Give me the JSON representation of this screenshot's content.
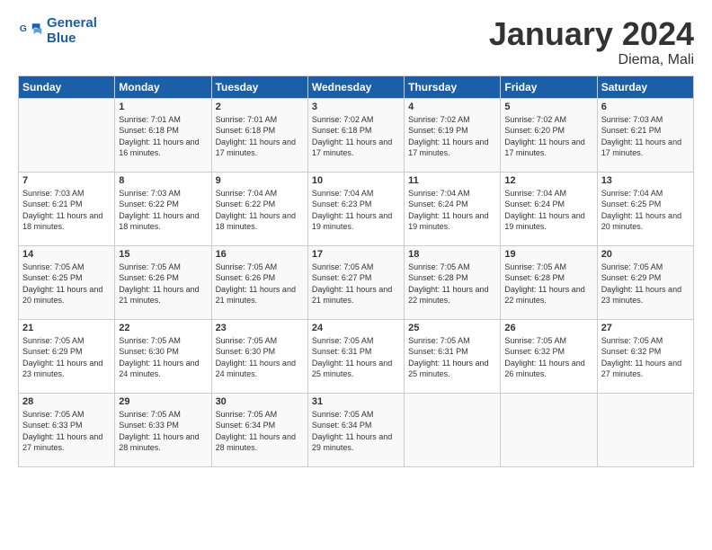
{
  "header": {
    "logo_line1": "General",
    "logo_line2": "Blue",
    "title": "January 2024",
    "location": "Diema, Mali"
  },
  "weekdays": [
    "Sunday",
    "Monday",
    "Tuesday",
    "Wednesday",
    "Thursday",
    "Friday",
    "Saturday"
  ],
  "weeks": [
    [
      {
        "day": "",
        "sunrise": "",
        "sunset": "",
        "daylight": ""
      },
      {
        "day": "1",
        "sunrise": "Sunrise: 7:01 AM",
        "sunset": "Sunset: 6:18 PM",
        "daylight": "Daylight: 11 hours and 16 minutes."
      },
      {
        "day": "2",
        "sunrise": "Sunrise: 7:01 AM",
        "sunset": "Sunset: 6:18 PM",
        "daylight": "Daylight: 11 hours and 17 minutes."
      },
      {
        "day": "3",
        "sunrise": "Sunrise: 7:02 AM",
        "sunset": "Sunset: 6:18 PM",
        "daylight": "Daylight: 11 hours and 17 minutes."
      },
      {
        "day": "4",
        "sunrise": "Sunrise: 7:02 AM",
        "sunset": "Sunset: 6:19 PM",
        "daylight": "Daylight: 11 hours and 17 minutes."
      },
      {
        "day": "5",
        "sunrise": "Sunrise: 7:02 AM",
        "sunset": "Sunset: 6:20 PM",
        "daylight": "Daylight: 11 hours and 17 minutes."
      },
      {
        "day": "6",
        "sunrise": "Sunrise: 7:03 AM",
        "sunset": "Sunset: 6:21 PM",
        "daylight": "Daylight: 11 hours and 17 minutes."
      }
    ],
    [
      {
        "day": "7",
        "sunrise": "Sunrise: 7:03 AM",
        "sunset": "Sunset: 6:21 PM",
        "daylight": "Daylight: 11 hours and 18 minutes."
      },
      {
        "day": "8",
        "sunrise": "Sunrise: 7:03 AM",
        "sunset": "Sunset: 6:22 PM",
        "daylight": "Daylight: 11 hours and 18 minutes."
      },
      {
        "day": "9",
        "sunrise": "Sunrise: 7:04 AM",
        "sunset": "Sunset: 6:22 PM",
        "daylight": "Daylight: 11 hours and 18 minutes."
      },
      {
        "day": "10",
        "sunrise": "Sunrise: 7:04 AM",
        "sunset": "Sunset: 6:23 PM",
        "daylight": "Daylight: 11 hours and 19 minutes."
      },
      {
        "day": "11",
        "sunrise": "Sunrise: 7:04 AM",
        "sunset": "Sunset: 6:24 PM",
        "daylight": "Daylight: 11 hours and 19 minutes."
      },
      {
        "day": "12",
        "sunrise": "Sunrise: 7:04 AM",
        "sunset": "Sunset: 6:24 PM",
        "daylight": "Daylight: 11 hours and 19 minutes."
      },
      {
        "day": "13",
        "sunrise": "Sunrise: 7:04 AM",
        "sunset": "Sunset: 6:25 PM",
        "daylight": "Daylight: 11 hours and 20 minutes."
      }
    ],
    [
      {
        "day": "14",
        "sunrise": "Sunrise: 7:05 AM",
        "sunset": "Sunset: 6:25 PM",
        "daylight": "Daylight: 11 hours and 20 minutes."
      },
      {
        "day": "15",
        "sunrise": "Sunrise: 7:05 AM",
        "sunset": "Sunset: 6:26 PM",
        "daylight": "Daylight: 11 hours and 21 minutes."
      },
      {
        "day": "16",
        "sunrise": "Sunrise: 7:05 AM",
        "sunset": "Sunset: 6:26 PM",
        "daylight": "Daylight: 11 hours and 21 minutes."
      },
      {
        "day": "17",
        "sunrise": "Sunrise: 7:05 AM",
        "sunset": "Sunset: 6:27 PM",
        "daylight": "Daylight: 11 hours and 21 minutes."
      },
      {
        "day": "18",
        "sunrise": "Sunrise: 7:05 AM",
        "sunset": "Sunset: 6:28 PM",
        "daylight": "Daylight: 11 hours and 22 minutes."
      },
      {
        "day": "19",
        "sunrise": "Sunrise: 7:05 AM",
        "sunset": "Sunset: 6:28 PM",
        "daylight": "Daylight: 11 hours and 22 minutes."
      },
      {
        "day": "20",
        "sunrise": "Sunrise: 7:05 AM",
        "sunset": "Sunset: 6:29 PM",
        "daylight": "Daylight: 11 hours and 23 minutes."
      }
    ],
    [
      {
        "day": "21",
        "sunrise": "Sunrise: 7:05 AM",
        "sunset": "Sunset: 6:29 PM",
        "daylight": "Daylight: 11 hours and 23 minutes."
      },
      {
        "day": "22",
        "sunrise": "Sunrise: 7:05 AM",
        "sunset": "Sunset: 6:30 PM",
        "daylight": "Daylight: 11 hours and 24 minutes."
      },
      {
        "day": "23",
        "sunrise": "Sunrise: 7:05 AM",
        "sunset": "Sunset: 6:30 PM",
        "daylight": "Daylight: 11 hours and 24 minutes."
      },
      {
        "day": "24",
        "sunrise": "Sunrise: 7:05 AM",
        "sunset": "Sunset: 6:31 PM",
        "daylight": "Daylight: 11 hours and 25 minutes."
      },
      {
        "day": "25",
        "sunrise": "Sunrise: 7:05 AM",
        "sunset": "Sunset: 6:31 PM",
        "daylight": "Daylight: 11 hours and 25 minutes."
      },
      {
        "day": "26",
        "sunrise": "Sunrise: 7:05 AM",
        "sunset": "Sunset: 6:32 PM",
        "daylight": "Daylight: 11 hours and 26 minutes."
      },
      {
        "day": "27",
        "sunrise": "Sunrise: 7:05 AM",
        "sunset": "Sunset: 6:32 PM",
        "daylight": "Daylight: 11 hours and 27 minutes."
      }
    ],
    [
      {
        "day": "28",
        "sunrise": "Sunrise: 7:05 AM",
        "sunset": "Sunset: 6:33 PM",
        "daylight": "Daylight: 11 hours and 27 minutes."
      },
      {
        "day": "29",
        "sunrise": "Sunrise: 7:05 AM",
        "sunset": "Sunset: 6:33 PM",
        "daylight": "Daylight: 11 hours and 28 minutes."
      },
      {
        "day": "30",
        "sunrise": "Sunrise: 7:05 AM",
        "sunset": "Sunset: 6:34 PM",
        "daylight": "Daylight: 11 hours and 28 minutes."
      },
      {
        "day": "31",
        "sunrise": "Sunrise: 7:05 AM",
        "sunset": "Sunset: 6:34 PM",
        "daylight": "Daylight: 11 hours and 29 minutes."
      },
      {
        "day": "",
        "sunrise": "",
        "sunset": "",
        "daylight": ""
      },
      {
        "day": "",
        "sunrise": "",
        "sunset": "",
        "daylight": ""
      },
      {
        "day": "",
        "sunrise": "",
        "sunset": "",
        "daylight": ""
      }
    ]
  ]
}
